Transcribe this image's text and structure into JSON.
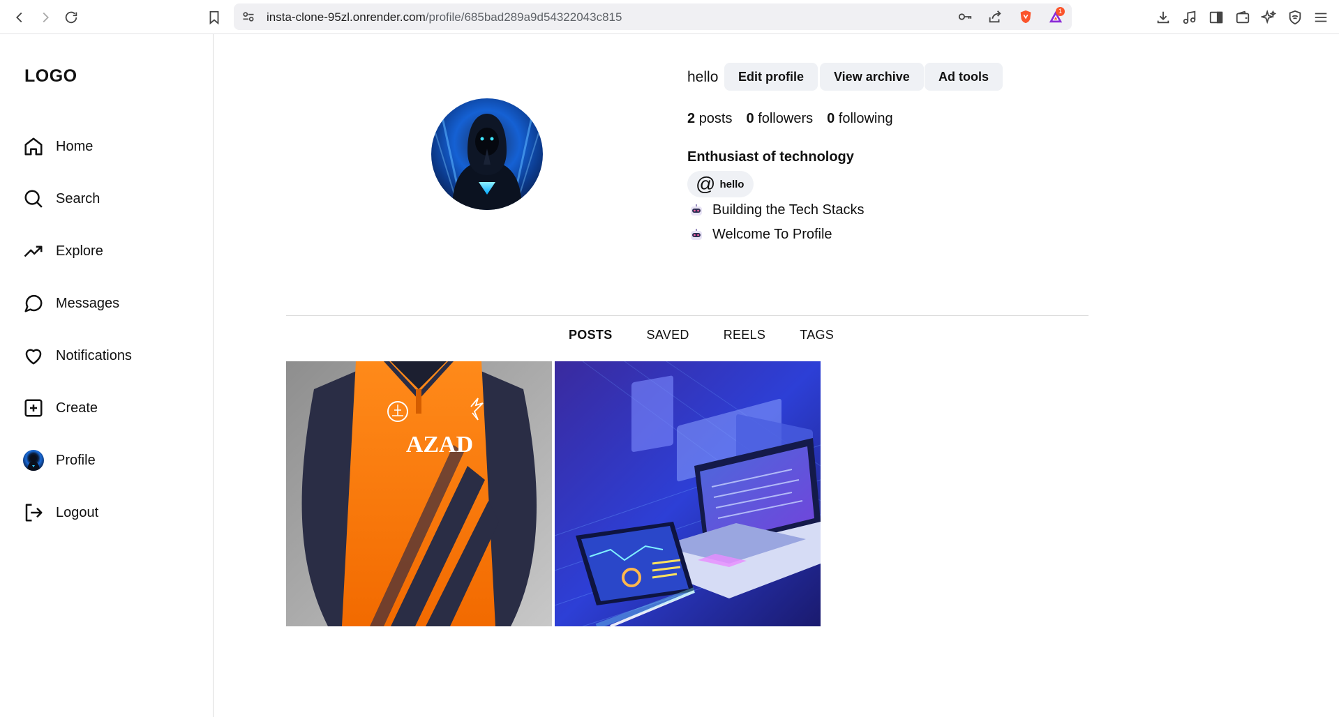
{
  "browser": {
    "url_host": "insta-clone-95zl.onrender.com",
    "url_path": "/profile/685bad289a9d54322043c815",
    "notification_count": "1"
  },
  "sidebar": {
    "logo": "LOGO",
    "items": [
      {
        "label": "Home",
        "icon": "home-icon"
      },
      {
        "label": "Search",
        "icon": "search-icon"
      },
      {
        "label": "Explore",
        "icon": "trending-icon"
      },
      {
        "label": "Messages",
        "icon": "message-circle-icon"
      },
      {
        "label": "Notifications",
        "icon": "heart-icon"
      },
      {
        "label": "Create",
        "icon": "plus-square-icon"
      },
      {
        "label": "Profile",
        "icon": "avatar"
      },
      {
        "label": "Logout",
        "icon": "logout-icon"
      }
    ]
  },
  "profile": {
    "username": "hello",
    "buttons": {
      "edit": "Edit profile",
      "archive": "View archive",
      "ad_tools": "Ad tools"
    },
    "stats": {
      "posts_count": "2",
      "posts_label": "posts",
      "followers_count": "0",
      "followers_label": "followers",
      "following_count": "0",
      "following_label": "following"
    },
    "display_name": "Enthusiast of technology",
    "handle": "hello",
    "bio_lines": [
      "Building the Tech Stacks",
      "Welcome To Profile"
    ]
  },
  "tabs": [
    "POSTS",
    "SAVED",
    "REELS",
    "TAGS"
  ],
  "active_tab": "POSTS",
  "posts": [
    {
      "jersey_text": "AZAD"
    },
    {}
  ],
  "colors": {
    "button_bg": "#eff1f5",
    "divider": "#dbdbdb",
    "brave_orange": "#fb542b"
  }
}
